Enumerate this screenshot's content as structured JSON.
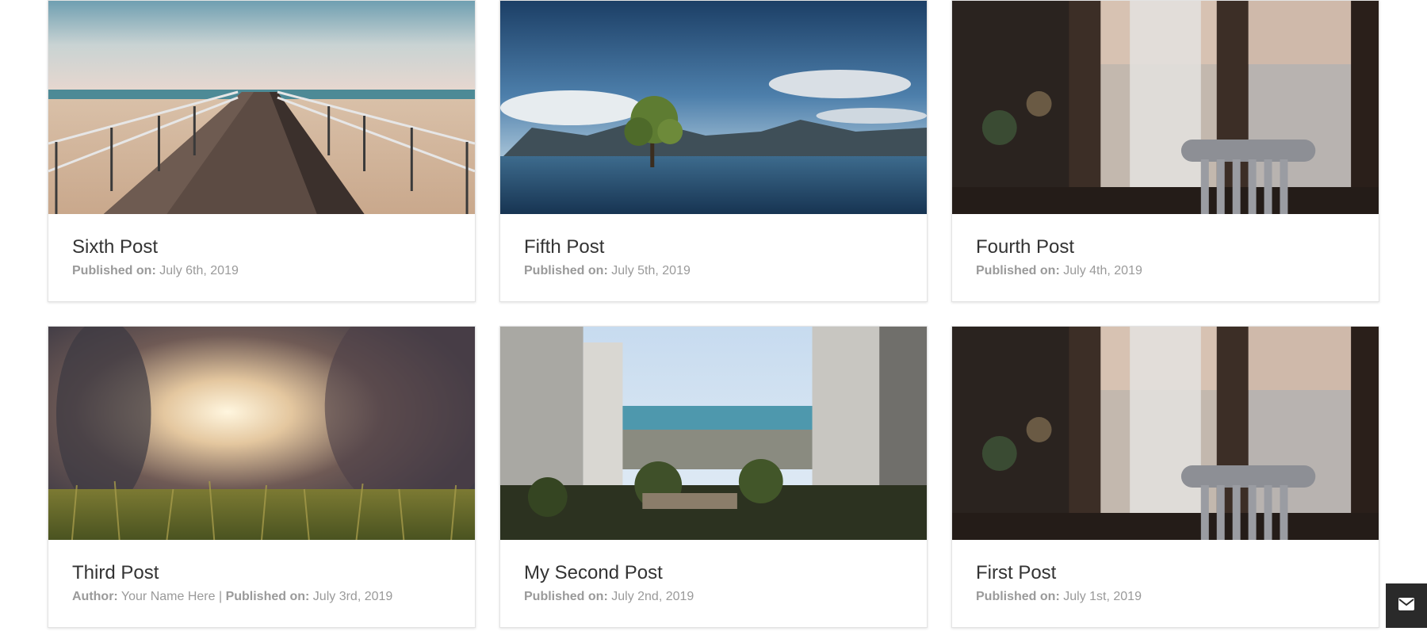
{
  "posts": [
    {
      "title": "Sixth Post",
      "published_label": "Published on:",
      "published_date": "July 6th, 2019",
      "image": "boardwalk-beach"
    },
    {
      "title": "Fifth Post",
      "published_label": "Published on:",
      "published_date": "July 5th, 2019",
      "image": "lake-tree-mountains"
    },
    {
      "title": "Fourth Post",
      "published_label": "Published on:",
      "published_date": "July 4th, 2019",
      "image": "window-chair"
    },
    {
      "title": "Third Post",
      "author_label": "Author:",
      "author_name": "Your Name Here",
      "separator": "|",
      "published_label": "Published on:",
      "published_date": "July 3rd, 2019",
      "image": "sunlight-grass"
    },
    {
      "title": "My Second Post",
      "published_label": "Published on:",
      "published_date": "July 2nd, 2019",
      "image": "city-sea-view"
    },
    {
      "title": "First Post",
      "published_label": "Published on:",
      "published_date": "July 1st, 2019",
      "image": "window-chair"
    }
  ],
  "contact_button": {
    "icon": "envelope-icon"
  },
  "colors": {
    "meta_text": "#9a9a9a",
    "title_text": "#333333",
    "contact_bg": "#2a2a2a"
  }
}
